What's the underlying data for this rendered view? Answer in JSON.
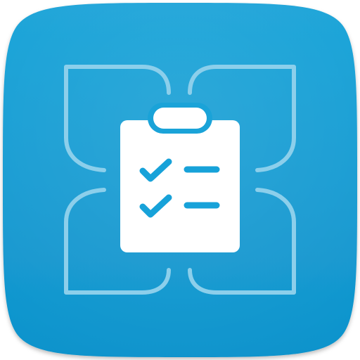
{
  "icon": {
    "kind": "app-icon",
    "glyph": "clipboard-checklist-icon",
    "frame_glyph": "four-petal-outline",
    "colors": {
      "tile_top": "#1aa3d8",
      "tile_bottom": "#0f93cc",
      "tile_edge": "#0b7fb3",
      "outline": "#8ccfeb",
      "clipboard": "#ffffff",
      "checklist_marks": "#17a2d9"
    },
    "checklist_items": 2
  }
}
